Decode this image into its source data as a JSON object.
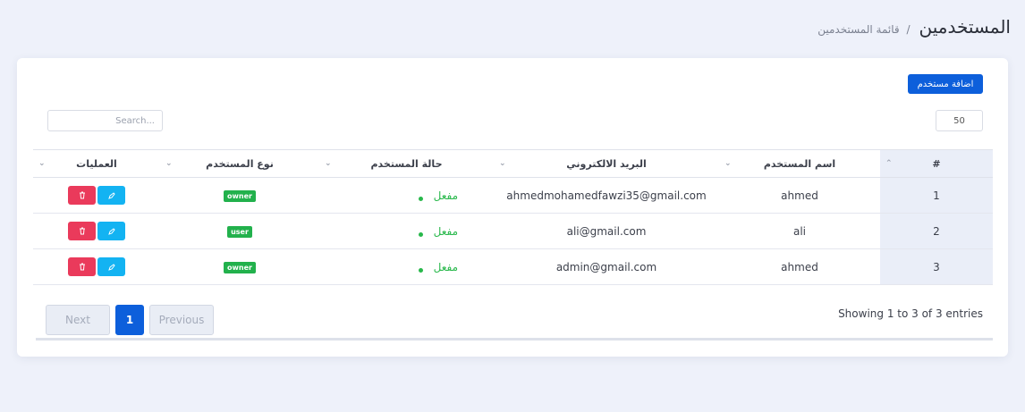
{
  "header": {
    "title": "المستخدمين",
    "breadcrumb_sep": "/",
    "breadcrumb": "قائمة المستخدمين"
  },
  "toolbar": {
    "add_label": "اضافة مستخدم",
    "search_placeholder": "Search...",
    "page_size": "50"
  },
  "table": {
    "columns": [
      "#",
      "اسم المستخدم",
      "البريد الالكتروني",
      "حالة المستخدم",
      "نوع المستخدم",
      "العمليات"
    ],
    "rows": [
      {
        "num": "1",
        "name": "ahmed",
        "email": "ahmedmohamedfawzi35@gmail.com",
        "status": "مفعل",
        "type": "owner"
      },
      {
        "num": "2",
        "name": "ali",
        "email": "ali@gmail.com",
        "status": "مفعل",
        "type": "user"
      },
      {
        "num": "3",
        "name": "ahmed",
        "email": "admin@gmail.com",
        "status": "مفعل",
        "type": "owner"
      }
    ]
  },
  "footer": {
    "info": "Showing 1 to 3 of 3 entries",
    "next_label": "Next",
    "current_page": "1",
    "previous_label": "Previous"
  },
  "colors": {
    "accent": "#0d5fdb",
    "success": "#22b14c",
    "danger": "#ea3a5b",
    "info": "#13b3f2"
  },
  "icons": {
    "edit": "pencil-icon",
    "delete": "trash-icon",
    "sort": "chevron-icon"
  }
}
